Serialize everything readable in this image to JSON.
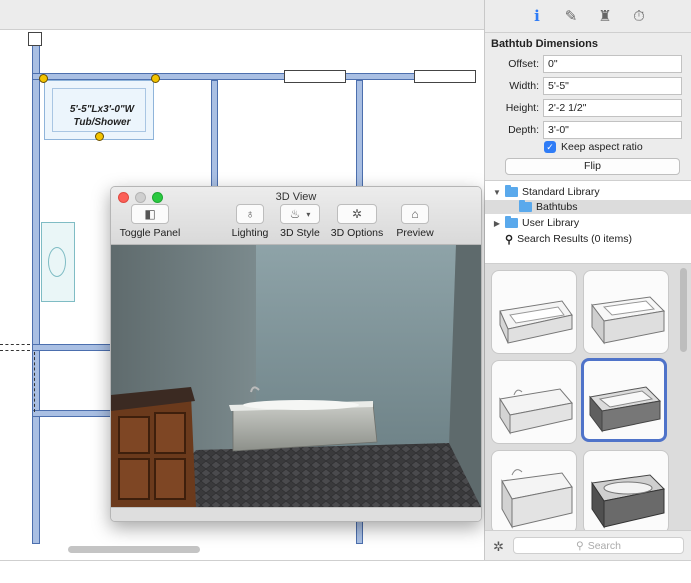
{
  "plan": {
    "tub_label_line1": "5'-5\"Lx3'-0\"W",
    "tub_label_line2": "Tub/Shower"
  },
  "view3d": {
    "title": "3D View",
    "toolbar": [
      {
        "label": "Toggle Panel",
        "icon": "toggle-panel-icon"
      },
      {
        "label": "Lighting",
        "icon": "lightbulb-icon"
      },
      {
        "label": "3D Style",
        "icon": "paint-bucket-icon"
      },
      {
        "label": "3D Options",
        "icon": "gear-icon"
      },
      {
        "label": "Preview",
        "icon": "home-icon"
      }
    ]
  },
  "panel": {
    "tabs": [
      {
        "name": "info",
        "glyph": "i"
      },
      {
        "name": "style",
        "glyph": "✎"
      },
      {
        "name": "furniture",
        "glyph": "♜"
      },
      {
        "name": "timer",
        "glyph": "⏱"
      }
    ],
    "section_title": "Bathtub Dimensions",
    "fields": [
      {
        "label": "Offset:",
        "value": "0\""
      },
      {
        "label": "Width:",
        "value": "5'-5\""
      },
      {
        "label": "Height:",
        "value": "2'-2 1/2\""
      },
      {
        "label": "Depth:",
        "value": "3'-0\""
      }
    ],
    "keep_aspect": {
      "label": "Keep aspect ratio",
      "checked": true
    },
    "flip_label": "Flip",
    "tree": {
      "standard_library": "Standard Library",
      "bathtubs": "Bathtubs",
      "user_library": "User Library",
      "search_results": "Search Results (0 items)"
    },
    "search_placeholder": "Search",
    "colors": {
      "accent": "#2f7cf6",
      "selection": "#4f73c9"
    }
  }
}
